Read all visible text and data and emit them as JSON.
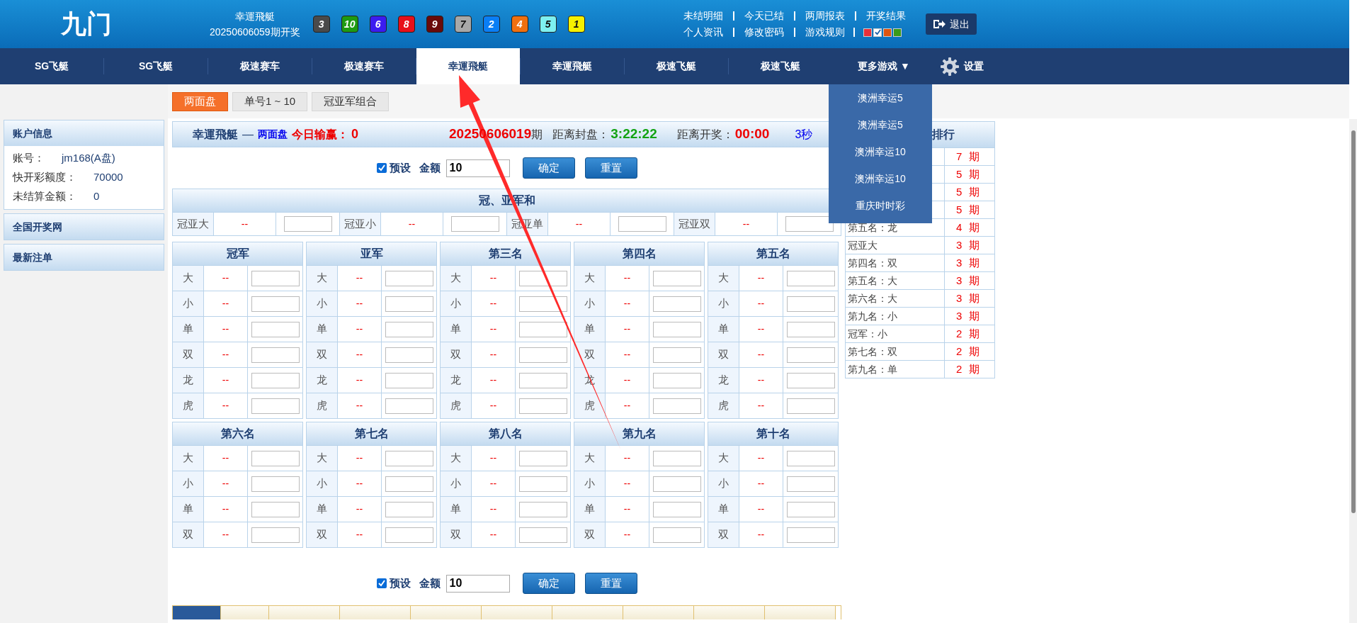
{
  "logo": "九门",
  "draw": {
    "game": "幸運飛艇",
    "issue": "20250606059期开奖",
    "balls": [
      {
        "number": "3",
        "color": "#4a4a4a"
      },
      {
        "number": "10",
        "color": "#1f9a12"
      },
      {
        "number": "6",
        "color": "#3b1cf0"
      },
      {
        "number": "8",
        "color": "#e8101a"
      },
      {
        "number": "9",
        "color": "#6a0a0a"
      },
      {
        "number": "7",
        "color": "#a8a8a8"
      },
      {
        "number": "2",
        "color": "#0a7ef5"
      },
      {
        "number": "4",
        "color": "#f07010"
      },
      {
        "number": "5",
        "color": "#7ef0f0"
      },
      {
        "number": "1",
        "color": "#f5f000"
      }
    ]
  },
  "top_links": [
    {
      "items": [
        "未结明细",
        "今天已结",
        "两周报表",
        "开奖结果"
      ]
    },
    {
      "items": [
        "个人资讯",
        "修改密码",
        "游戏规则"
      ]
    }
  ],
  "themes": [
    {
      "color": "#e8303a",
      "selected": false
    },
    {
      "color": "#ffffff",
      "selected": true
    },
    {
      "color": "#dd5510",
      "selected": false
    },
    {
      "color": "#3a9a1a",
      "selected": false
    }
  ],
  "logout": "退出",
  "nav": [
    {
      "label": "SG飞艇",
      "selected": false
    },
    {
      "label": "SG飞艇",
      "selected": false
    },
    {
      "label": "极速赛车",
      "selected": false
    },
    {
      "label": "极速赛车",
      "selected": false
    },
    {
      "label": "幸運飛艇",
      "selected": true
    },
    {
      "label": "幸運飛艇",
      "selected": false
    },
    {
      "label": "极速飞艇",
      "selected": false
    },
    {
      "label": "极速飞艇",
      "selected": false
    }
  ],
  "more_games": "更多游戏 ▼",
  "settings": "设置",
  "dropdown": [
    "澳洲幸运5",
    "澳洲幸运5",
    "澳洲幸运10",
    "澳洲幸运10",
    "重庆时时彩"
  ],
  "sub_tabs": [
    {
      "label": "两面盘",
      "selected": true
    },
    {
      "label": "单号1 ~ 10",
      "selected": false
    },
    {
      "label": "冠亚军组合",
      "selected": false
    }
  ],
  "sidebar": {
    "account": {
      "title": "账户信息",
      "rows": [
        {
          "label": "账号：",
          "value": "jm168(A盘)"
        },
        {
          "label": "快开彩额度：",
          "value": "70000"
        },
        {
          "label": "未结算金额：",
          "value": "0"
        }
      ]
    },
    "sections": [
      "全国开奖网",
      "最新注单"
    ]
  },
  "title_bar": {
    "game": "幸運飛艇",
    "separator": "—",
    "mode": "两面盘",
    "pnl_label": "今日输赢：",
    "pnl": "0",
    "issue_number": "20250606019",
    "issue_suffix": "期",
    "close_label": "距离封盘：",
    "close_time": "3:22:22",
    "draw_label": "距离开奖：",
    "draw_time": "00:00",
    "refresh": "3秒"
  },
  "bet_forms": [
    {
      "preset": "预设",
      "checked": true,
      "amount_label": "金额",
      "amount": "10",
      "confirm": "确定",
      "reset": "重置"
    },
    {
      "preset": "预设",
      "checked": true,
      "amount_label": "金额",
      "amount": "10",
      "confirm": "确定",
      "reset": "重置"
    }
  ],
  "sum_table": {
    "title": "冠、亚军和",
    "items": [
      {
        "label": "冠亚大",
        "odds": "--"
      },
      {
        "label": "冠亚小",
        "odds": "--"
      },
      {
        "label": "冠亚单",
        "odds": "--"
      },
      {
        "label": "冠亚双",
        "odds": "--"
      }
    ]
  },
  "positions": [
    {
      "title": "冠军",
      "rows": [
        {
          "label": "大",
          "odds": "--"
        },
        {
          "label": "小",
          "odds": "--"
        },
        {
          "label": "单",
          "odds": "--"
        },
        {
          "label": "双",
          "odds": "--"
        },
        {
          "label": "龙",
          "odds": "--"
        },
        {
          "label": "虎",
          "odds": "--"
        }
      ]
    },
    {
      "title": "亚军",
      "rows": [
        {
          "label": "大",
          "odds": "--"
        },
        {
          "label": "小",
          "odds": "--"
        },
        {
          "label": "单",
          "odds": "--"
        },
        {
          "label": "双",
          "odds": "--"
        },
        {
          "label": "龙",
          "odds": "--"
        },
        {
          "label": "虎",
          "odds": "--"
        }
      ]
    },
    {
      "title": "第三名",
      "rows": [
        {
          "label": "大",
          "odds": "--"
        },
        {
          "label": "小",
          "odds": "--"
        },
        {
          "label": "单",
          "odds": "--"
        },
        {
          "label": "双",
          "odds": "--"
        },
        {
          "label": "龙",
          "odds": "--"
        },
        {
          "label": "虎",
          "odds": "--"
        }
      ]
    },
    {
      "title": "第四名",
      "rows": [
        {
          "label": "大",
          "odds": "--"
        },
        {
          "label": "小",
          "odds": "--"
        },
        {
          "label": "单",
          "odds": "--"
        },
        {
          "label": "双",
          "odds": "--"
        },
        {
          "label": "龙",
          "odds": "--"
        },
        {
          "label": "虎",
          "odds": "--"
        }
      ]
    },
    {
      "title": "第五名",
      "rows": [
        {
          "label": "大",
          "odds": "--"
        },
        {
          "label": "小",
          "odds": "--"
        },
        {
          "label": "单",
          "odds": "--"
        },
        {
          "label": "双",
          "odds": "--"
        },
        {
          "label": "龙",
          "odds": "--"
        },
        {
          "label": "虎",
          "odds": "--"
        }
      ]
    },
    {
      "title": "第六名",
      "rows": [
        {
          "label": "大",
          "odds": "--"
        },
        {
          "label": "小",
          "odds": "--"
        },
        {
          "label": "单",
          "odds": "--"
        },
        {
          "label": "双",
          "odds": "--"
        }
      ]
    },
    {
      "title": "第七名",
      "rows": [
        {
          "label": "大",
          "odds": "--"
        },
        {
          "label": "小",
          "odds": "--"
        },
        {
          "label": "单",
          "odds": "--"
        },
        {
          "label": "双",
          "odds": "--"
        }
      ]
    },
    {
      "title": "第八名",
      "rows": [
        {
          "label": "大",
          "odds": "--"
        },
        {
          "label": "小",
          "odds": "--"
        },
        {
          "label": "单",
          "odds": "--"
        },
        {
          "label": "双",
          "odds": "--"
        }
      ]
    },
    {
      "title": "第九名",
      "rows": [
        {
          "label": "大",
          "odds": "--"
        },
        {
          "label": "小",
          "odds": "--"
        },
        {
          "label": "单",
          "odds": "--"
        },
        {
          "label": "双",
          "odds": "--"
        }
      ]
    },
    {
      "title": "第十名",
      "rows": [
        {
          "label": "大",
          "odds": "--"
        },
        {
          "label": "小",
          "odds": "--"
        },
        {
          "label": "单",
          "odds": "--"
        },
        {
          "label": "双",
          "odds": "--"
        }
      ]
    }
  ],
  "ranking": {
    "title": "排行",
    "rows": [
      {
        "count": "7",
        "unit": "期"
      },
      {
        "count": "5",
        "unit": "期"
      },
      {
        "count": "5",
        "unit": "期"
      },
      {
        "count": "5",
        "unit": "期"
      },
      {
        "label": "第五名：龙",
        "count": "4",
        "unit": "期"
      },
      {
        "label": "冠亚大",
        "count": "3",
        "unit": "期"
      },
      {
        "label": "第四名：双",
        "count": "3",
        "unit": "期"
      },
      {
        "label": "第五名：大",
        "count": "3",
        "unit": "期"
      },
      {
        "label": "第六名：大",
        "count": "3",
        "unit": "期"
      },
      {
        "label": "第九名：小",
        "count": "3",
        "unit": "期"
      },
      {
        "label": "冠军：小",
        "count": "2",
        "unit": "期"
      },
      {
        "label": "第七名：双",
        "count": "2",
        "unit": "期"
      },
      {
        "label": "第九名：单",
        "count": "2",
        "unit": "期"
      }
    ]
  },
  "bottom_tabs": [
    {
      "selected": true
    },
    {
      "selected": false
    },
    {
      "selected": false
    },
    {
      "selected": false
    },
    {
      "selected": false
    },
    {
      "selected": false
    },
    {
      "selected": false
    },
    {
      "selected": false
    },
    {
      "selected": false
    },
    {
      "selected": false
    }
  ]
}
